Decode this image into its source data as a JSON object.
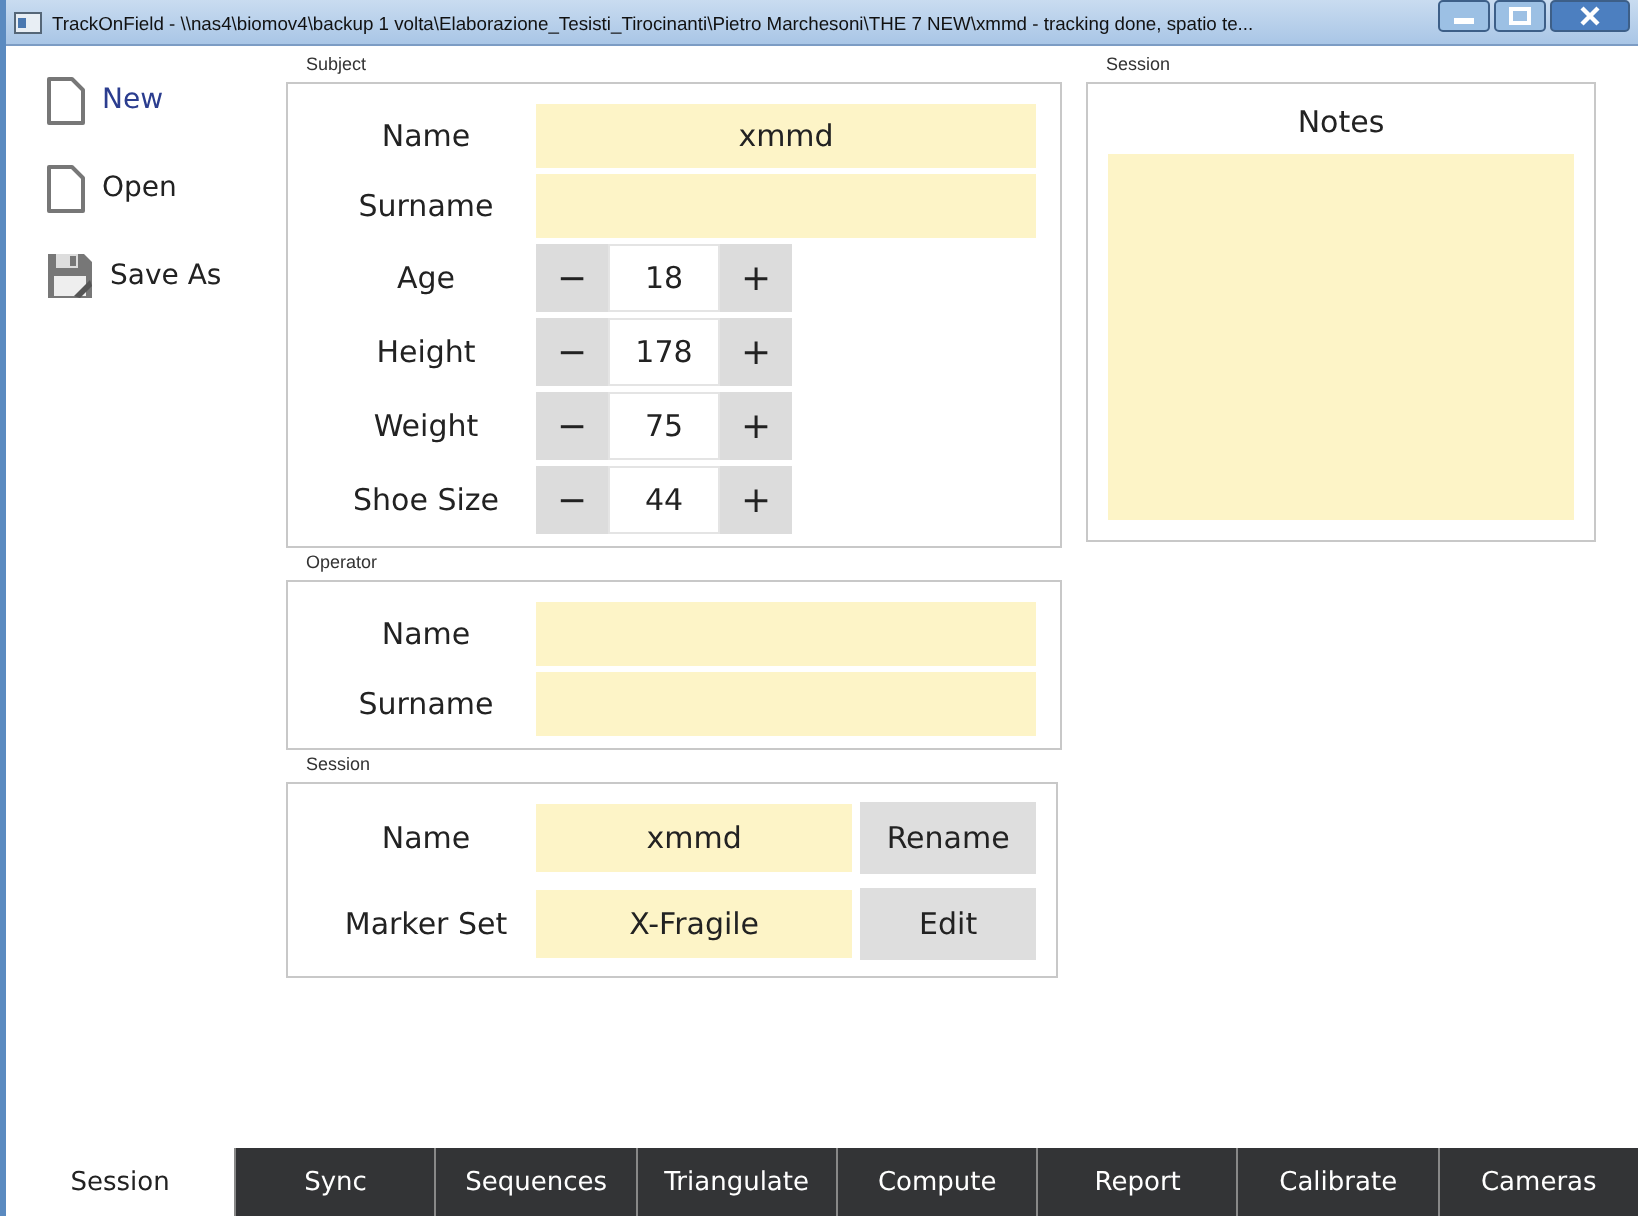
{
  "window": {
    "title": "TrackOnField - \\\\nas4\\biomov4\\backup 1 volta\\Elaborazione_Tesisti_Tirocinanti\\Pietro Marchesoni\\THE 7 NEW\\xmmd - tracking done, spatio te..."
  },
  "sidebar": {
    "items": [
      {
        "label": "New",
        "kind": "new",
        "selected": true
      },
      {
        "label": "Open",
        "kind": "open",
        "selected": false
      },
      {
        "label": "Save As",
        "kind": "save",
        "selected": false
      }
    ]
  },
  "subject": {
    "title": "Subject",
    "fields": [
      {
        "kind": "text",
        "label": "Name",
        "value": "xmmd"
      },
      {
        "kind": "text",
        "label": "Surname"
      },
      {
        "kind": "stepper",
        "label": "Age",
        "value": "18",
        "minus": "−",
        "plus": "+"
      },
      {
        "kind": "stepper",
        "label": "Height",
        "value": "178",
        "minus": "−",
        "plus": "+"
      },
      {
        "kind": "stepper",
        "label": "Weight",
        "value": "75",
        "minus": "−",
        "plus": "+"
      },
      {
        "kind": "stepper",
        "label": "Shoe Size",
        "value": "44",
        "minus": "−",
        "plus": "+"
      }
    ]
  },
  "operator": {
    "title": "Operator",
    "fields": [
      {
        "kind": "text",
        "label": "Name"
      },
      {
        "kind": "text",
        "label": "Surname"
      }
    ]
  },
  "session": {
    "title": "Session",
    "fields": [
      {
        "label": "Name",
        "value": "xmmd",
        "button": "Rename"
      },
      {
        "label": "Marker Set",
        "value": "X-Fragile",
        "button": "Edit"
      }
    ]
  },
  "session_notes": {
    "title": "Session",
    "heading": "Notes"
  },
  "tabs": [
    {
      "label": "Session",
      "selected": true
    },
    {
      "label": "Sync",
      "selected": false
    },
    {
      "label": "Sequences",
      "selected": false
    },
    {
      "label": "Triangulate",
      "selected": false
    },
    {
      "label": "Compute",
      "selected": false
    },
    {
      "label": "Report",
      "selected": false
    },
    {
      "label": "Calibrate",
      "selected": false
    },
    {
      "label": "Cameras",
      "selected": false
    }
  ]
}
